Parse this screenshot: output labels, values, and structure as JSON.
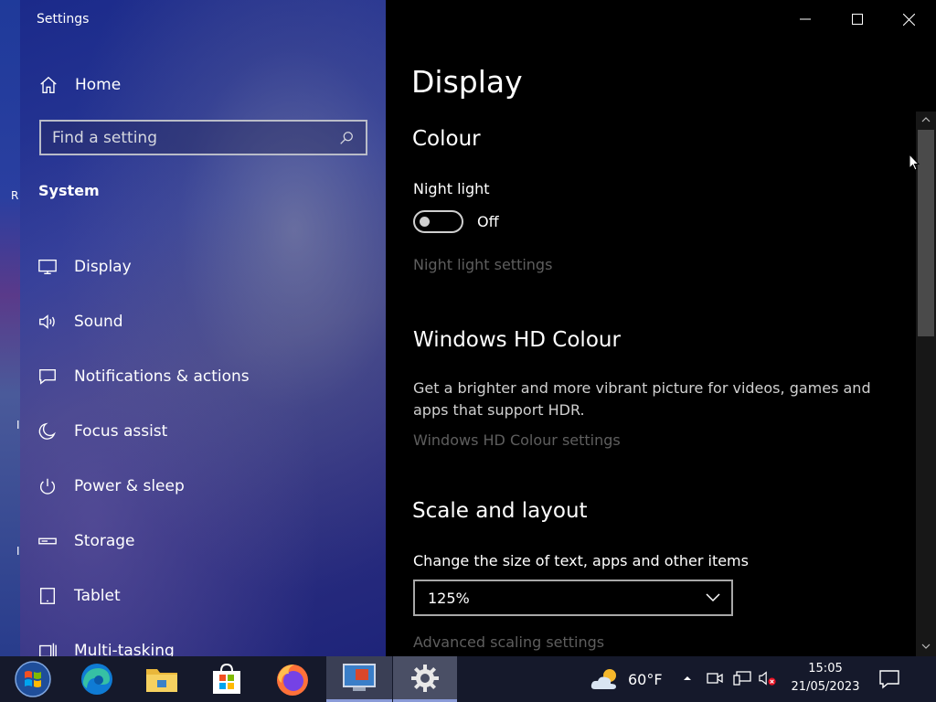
{
  "app": {
    "title": "Settings"
  },
  "sidebar": {
    "home_label": "Home",
    "search_placeholder": "Find a setting",
    "section": "System",
    "items": [
      {
        "label": "Display",
        "icon": "monitor-icon"
      },
      {
        "label": "Sound",
        "icon": "speaker-icon"
      },
      {
        "label": "Notifications & actions",
        "icon": "notification-icon"
      },
      {
        "label": "Focus assist",
        "icon": "moon-icon"
      },
      {
        "label": "Power & sleep",
        "icon": "power-icon"
      },
      {
        "label": "Storage",
        "icon": "storage-icon"
      },
      {
        "label": "Tablet",
        "icon": "tablet-icon"
      },
      {
        "label": "Multi-tasking",
        "icon": "multitasking-icon"
      }
    ]
  },
  "main": {
    "title": "Display",
    "colour": {
      "heading": "Colour",
      "night_light_label": "Night light",
      "night_light_state": "Off",
      "night_light_link": "Night light settings"
    },
    "hd_colour": {
      "heading": "Windows HD Colour",
      "description": "Get a brighter and more vibrant picture for videos, games and apps that support HDR.",
      "link": "Windows HD Colour settings"
    },
    "scale": {
      "heading": "Scale and layout",
      "label": "Change the size of text, apps and other items",
      "selected": "125%",
      "link": "Advanced scaling settings"
    }
  },
  "desktop": {
    "edge_letters": [
      "R",
      "I",
      "I"
    ]
  },
  "taskbar": {
    "apps": [
      "start-icon",
      "edge-icon",
      "file-explorer-icon",
      "store-icon",
      "firefox-icon",
      "remote-desktop-icon",
      "settings-icon"
    ],
    "weather_temp": "60°F",
    "time": "15:05",
    "date": "21/05/2023"
  }
}
